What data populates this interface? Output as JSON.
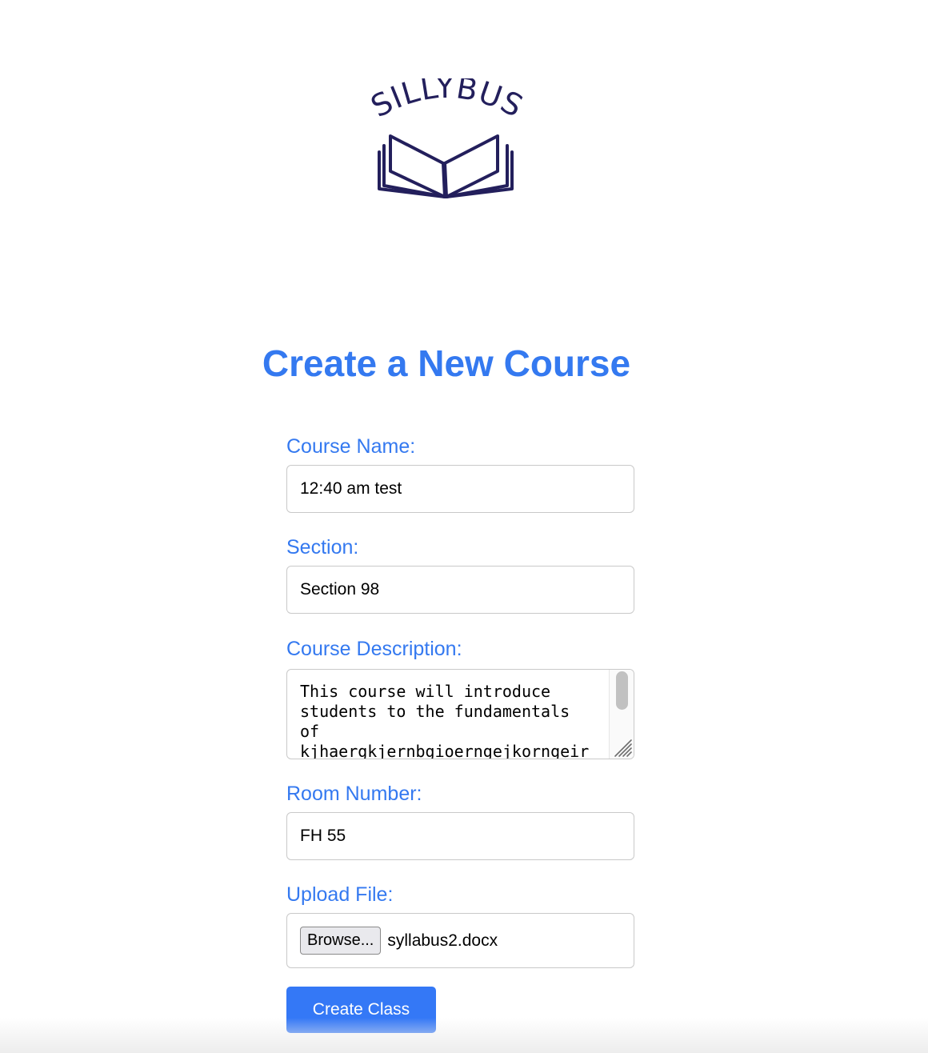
{
  "brand": {
    "logo_text": "SILLYBUS",
    "logo_color": "#231f5c",
    "accent_color": "#3479f0",
    "button_color": "#3478f6"
  },
  "page": {
    "title": "Create a New Course"
  },
  "form": {
    "course_name": {
      "label": "Course Name:",
      "value": "12:40 am test"
    },
    "section": {
      "label": "Section:",
      "value": "Section 98"
    },
    "description": {
      "label": "Course Description:",
      "lines": [
        "This course will introduce",
        "students to the fundamentals",
        "of",
        "kjhaergkjernbgioerngejkorngeir"
      ]
    },
    "room_number": {
      "label": "Room Number:",
      "value": "FH 55"
    },
    "upload": {
      "label": "Upload File:",
      "browse_label": "Browse...",
      "file_name": "syllabus2.docx"
    },
    "submit_label": "Create Class"
  }
}
